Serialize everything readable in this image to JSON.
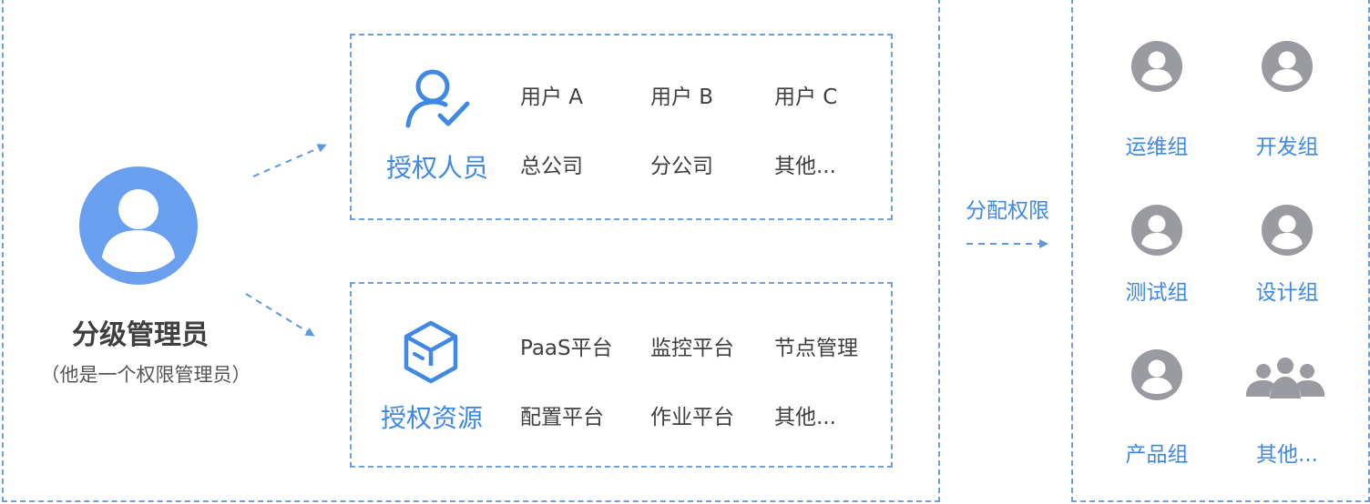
{
  "admin": {
    "title": "分级管理员",
    "subtitle": "（他是一个权限管理员）",
    "icon": "user-avatar-icon"
  },
  "authorized_people": {
    "title": "授权人员",
    "icon": "user-check-icon",
    "items": [
      "用户 A",
      "用户 B",
      "用户 C",
      "总公司",
      "分公司",
      "其他..."
    ]
  },
  "authorized_resources": {
    "title": "授权资源",
    "icon": "cube-icon",
    "items": [
      "PaaS平台",
      "监控平台",
      "节点管理",
      "配置平台",
      "作业平台",
      "其他..."
    ]
  },
  "assign_label": "分配权限",
  "groups": [
    {
      "label": "运维组",
      "icon": "user-icon"
    },
    {
      "label": "开发组",
      "icon": "user-icon"
    },
    {
      "label": "测试组",
      "icon": "user-icon"
    },
    {
      "label": "设计组",
      "icon": "user-icon"
    },
    {
      "label": "产品组",
      "icon": "user-icon"
    },
    {
      "label": "其他...",
      "icon": "group-icon"
    }
  ],
  "colors": {
    "accent": "#3f88e3",
    "dashed": "#6b9fde",
    "avatar": "#6a9ff0",
    "group_icon": "#9a9ba0",
    "text": "#3f3f3f"
  }
}
